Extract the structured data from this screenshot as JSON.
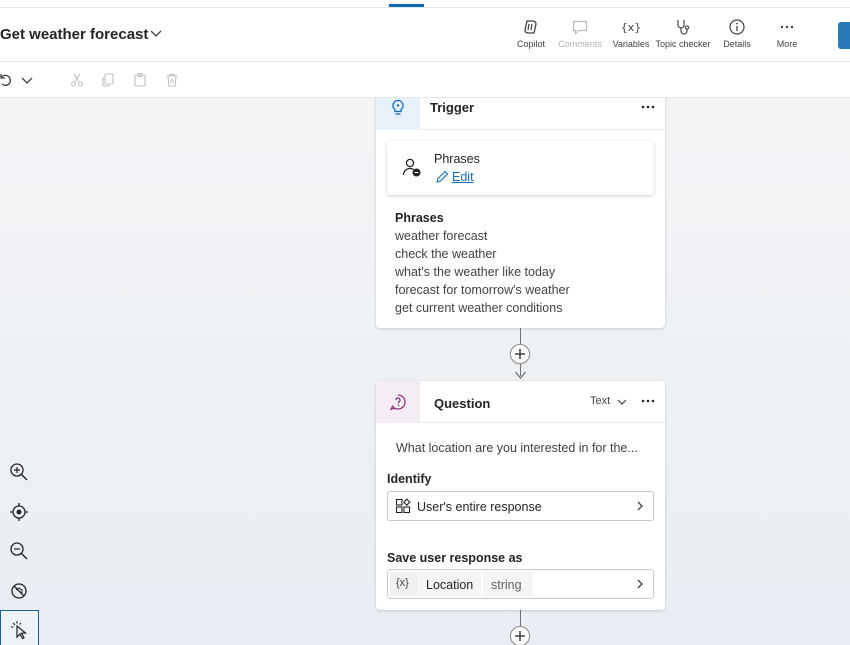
{
  "header": {
    "title": "Get weather forecast",
    "toolbar": [
      {
        "id": "copilot",
        "label": "Copilot",
        "icon": "copilot-icon",
        "enabled": true
      },
      {
        "id": "comments",
        "label": "Comments",
        "icon": "comment-icon",
        "enabled": false
      },
      {
        "id": "variables",
        "label": "Variables",
        "icon": "variables-icon",
        "enabled": true
      },
      {
        "id": "topic-checker",
        "label": "Topic checker",
        "icon": "stethoscope-icon",
        "enabled": true
      },
      {
        "id": "details",
        "label": "Details",
        "icon": "info-icon",
        "enabled": true
      },
      {
        "id": "more",
        "label": "More",
        "icon": "more-icon",
        "enabled": true
      }
    ]
  },
  "trigger": {
    "title": "Trigger",
    "phrases_card": {
      "title": "Phrases",
      "edit_label": "Edit"
    },
    "phrases": {
      "heading": "Phrases",
      "items": [
        "weather forecast",
        "check the weather",
        "what's the weather like today",
        "forecast for tomorrow's weather",
        "get current weather conditions"
      ]
    }
  },
  "question": {
    "title": "Question",
    "type_value": "Text",
    "prompt": "What location are you interested in for the...",
    "identify_label": "Identify",
    "identify_value": "User's entire response",
    "save_label": "Save user response as",
    "variable": {
      "icon_text": "{x}",
      "name": "Location",
      "type": "string"
    }
  },
  "colors": {
    "accent": "#0f6cbd",
    "trigger_icon_bg": "#e8f1fa",
    "question_icon_bg": "#f3ecf3"
  }
}
